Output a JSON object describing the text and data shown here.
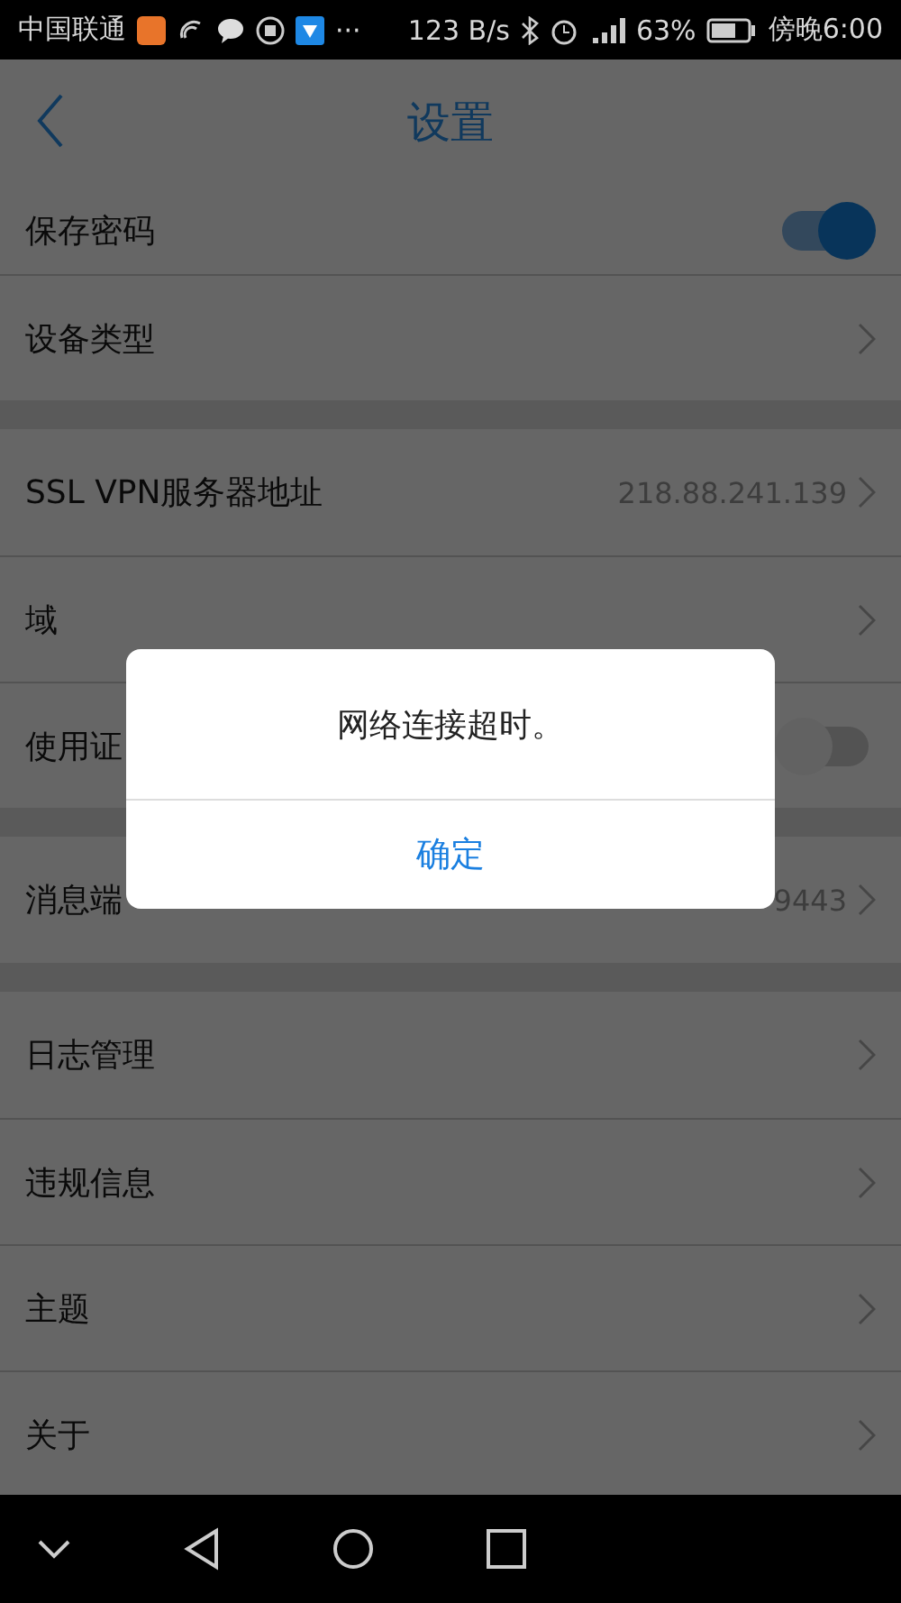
{
  "status_bar": {
    "carrier": "中国联通",
    "notice": "···",
    "speed": "123 B/s",
    "battery": "63%",
    "time": "傍晚6:00"
  },
  "header": {
    "title": "设置"
  },
  "sections": [
    {
      "items": [
        {
          "kind": "switch",
          "label": "保存密码",
          "on": true
        },
        {
          "kind": "link",
          "label": "设备类型"
        }
      ]
    },
    {
      "items": [
        {
          "kind": "link",
          "label": "SSL VPN服务器地址",
          "value": "218.88.241.139"
        },
        {
          "kind": "link",
          "label": "域"
        },
        {
          "kind": "switch",
          "label": "使用证",
          "on": false
        }
      ]
    },
    {
      "items": [
        {
          "kind": "link",
          "label": "消息端",
          "value": "9443"
        }
      ]
    },
    {
      "items": [
        {
          "kind": "link",
          "label": "日志管理"
        },
        {
          "kind": "link",
          "label": "违规信息"
        },
        {
          "kind": "link",
          "label": "主题"
        },
        {
          "kind": "link",
          "label": "关于"
        }
      ]
    }
  ],
  "dialog": {
    "message": "网络连接超时。",
    "button": "确定"
  }
}
